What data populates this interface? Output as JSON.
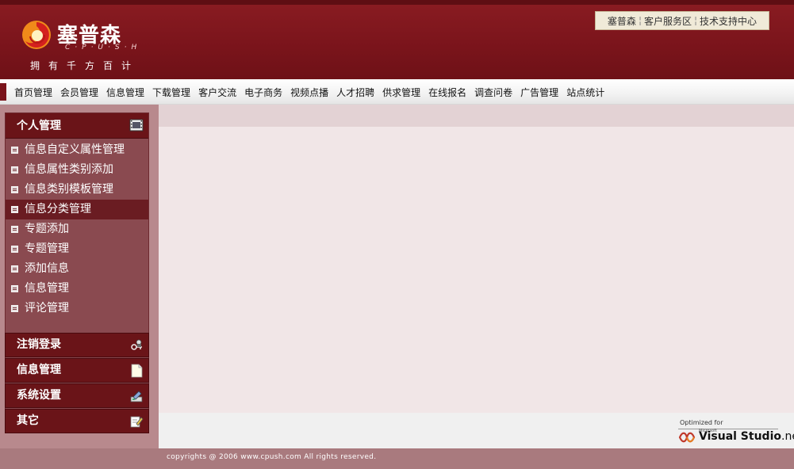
{
  "brand": {
    "name": "塞普森",
    "sub": "C·P·U·S·H",
    "slogan": "拥有千方百计"
  },
  "toplinks": {
    "items": [
      "塞普森",
      "客户服务区",
      "技术支持中心"
    ]
  },
  "nav": {
    "items": [
      "首页管理",
      "会员管理",
      "信息管理",
      "下载管理",
      "客户交流",
      "电子商务",
      "视频点播",
      "人才招聘",
      "供求管理",
      "在线报名",
      "调查问卷",
      "广告管理",
      "站点统计"
    ]
  },
  "sidebar": {
    "panel_title": "个人管理",
    "menu": [
      {
        "label": "信息自定义属性管理",
        "active": false
      },
      {
        "label": "信息属性类别添加",
        "active": false
      },
      {
        "label": "信息类别模板管理",
        "active": false
      },
      {
        "label": "信息分类管理",
        "active": true
      },
      {
        "label": "专题添加",
        "active": false
      },
      {
        "label": "专题管理",
        "active": false
      },
      {
        "label": "添加信息",
        "active": false
      },
      {
        "label": "信息管理",
        "active": false
      },
      {
        "label": "评论管理",
        "active": false
      }
    ],
    "sections": [
      {
        "label": "注销登录",
        "icon": "logout-icon"
      },
      {
        "label": "信息管理",
        "icon": "document-icon"
      },
      {
        "label": "系统设置",
        "icon": "settings-icon"
      },
      {
        "label": "其它",
        "icon": "edit-icon"
      }
    ]
  },
  "badge": {
    "optimized": "Optimized for",
    "microsoft": "Microsoft",
    "product": "Visual Studio",
    "suffix": ".net"
  },
  "footer": {
    "copyright": "copyrights @ 2006 www.cpush.com All rights reserved."
  },
  "colors": {
    "header": "#7a141b",
    "sidebar_panel": "#8a4a50",
    "sidebar_bg": "#b8898d",
    "main_bg": "#f1e6e7",
    "footer": "#a97a7e"
  }
}
